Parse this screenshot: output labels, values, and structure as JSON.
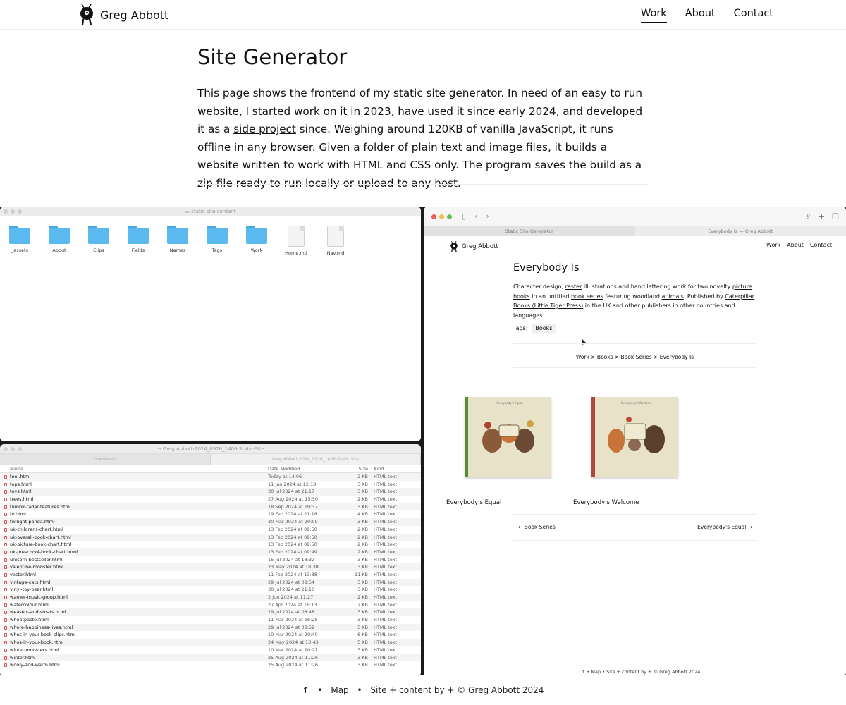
{
  "header": {
    "brand": "Greg Abbott",
    "nav": [
      {
        "label": "Work",
        "active": true
      },
      {
        "label": "About",
        "active": false
      },
      {
        "label": "Contact",
        "active": false
      }
    ]
  },
  "intro": {
    "title": "Site Generator",
    "text_1": "This page shows the frontend of my static site generator. In need of an easy to run website, I started work on it in 2023, have used it since early ",
    "link_year": "2024",
    "text_2": ", and developed it as a ",
    "link_side_project": "side project",
    "text_3": " since. Weighing around 120KB of vanilla JavaScript, it runs offline in any browser. Given a folder of plain text and image files, it builds a website written to work with HTML and CSS only. The program saves the build as a zip file ready to run locally or upload to any host."
  },
  "finder_content": {
    "title": "static site content",
    "items": [
      {
        "label": "_assets",
        "type": "folder"
      },
      {
        "label": "About",
        "type": "folder"
      },
      {
        "label": "Clips",
        "type": "folder"
      },
      {
        "label": "Fields",
        "type": "folder"
      },
      {
        "label": "Names",
        "type": "folder"
      },
      {
        "label": "Tags",
        "type": "folder"
      },
      {
        "label": "Work",
        "type": "folder"
      },
      {
        "label": "Home.md",
        "type": "file"
      },
      {
        "label": "Nav.md",
        "type": "file"
      }
    ]
  },
  "finder_build": {
    "title": "Greg Abbott-2024_0926_1406-Static-Site",
    "tabs": [
      "Downloads",
      "Greg Abbott-2024_0926_1406-Static-Site"
    ],
    "columns": {
      "name": "Name",
      "date": "Date Modified",
      "size": "Size",
      "kind": "Kind"
    },
    "rows": [
      {
        "name": "tool.html",
        "date": "Today at 14:06",
        "size": "2 KB",
        "kind": "HTML text"
      },
      {
        "name": "tops.html",
        "date": "11 Jan 2024 at 12:18",
        "size": "3 KB",
        "kind": "HTML text"
      },
      {
        "name": "toys.html",
        "date": "30 Jul 2024 at 21:17",
        "size": "3 KB",
        "kind": "HTML text"
      },
      {
        "name": "trees.html",
        "date": "27 Aug 2024 at 15:50",
        "size": "2 KB",
        "kind": "HTML text"
      },
      {
        "name": "tumblr-radar-features.html",
        "date": "18 Sep 2024 at 19:37",
        "size": "3 KB",
        "kind": "HTML text"
      },
      {
        "name": "tv.html",
        "date": "19 Feb 2024 at 21:18",
        "size": "4 KB",
        "kind": "HTML text"
      },
      {
        "name": "twilight-panda.html",
        "date": "30 Mar 2024 at 20:09",
        "size": "3 KB",
        "kind": "HTML text"
      },
      {
        "name": "uk-childrens-chart.html",
        "date": "13 Feb 2024 at 09:50",
        "size": "2 KB",
        "kind": "HTML text"
      },
      {
        "name": "uk-overall-book-chart.html",
        "date": "13 Feb 2024 at 09:50",
        "size": "2 KB",
        "kind": "HTML text"
      },
      {
        "name": "uk-picture-book-chart.html",
        "date": "13 Feb 2024 at 09:50",
        "size": "2 KB",
        "kind": "HTML text"
      },
      {
        "name": "uk-preschool-book-chart.html",
        "date": "13 Feb 2024 at 09:49",
        "size": "2 KB",
        "kind": "HTML text"
      },
      {
        "name": "unicorn-bestseller.html",
        "date": "15 Jul 2024 at 18:32",
        "size": "3 KB",
        "kind": "HTML text"
      },
      {
        "name": "valentine-monster.html",
        "date": "23 May 2024 at 18:38",
        "size": "3 KB",
        "kind": "HTML text"
      },
      {
        "name": "vector.html",
        "date": "11 Feb 2024 at 13:38",
        "size": "11 KB",
        "kind": "HTML text"
      },
      {
        "name": "vintage-cats.html",
        "date": "29 Jul 2024 at 08:54",
        "size": "3 KB",
        "kind": "HTML text"
      },
      {
        "name": "vinyl-toy-bear.html",
        "date": "30 Jul 2024 at 21:16",
        "size": "3 KB",
        "kind": "HTML text"
      },
      {
        "name": "warner-music-group.html",
        "date": "2 Jun 2024 at 11:27",
        "size": "2 KB",
        "kind": "HTML text"
      },
      {
        "name": "watercolour.html",
        "date": "27 Apr 2024 at 16:13",
        "size": "2 KB",
        "kind": "HTML text"
      },
      {
        "name": "weasels-and-stoats.html",
        "date": "29 Jul 2024 at 08:48",
        "size": "3 KB",
        "kind": "HTML text"
      },
      {
        "name": "wheatpaste.html",
        "date": "11 Mar 2024 at 16:28",
        "size": "3 KB",
        "kind": "HTML text"
      },
      {
        "name": "where-happiness-lives.html",
        "date": "29 Jul 2024 at 08:52",
        "size": "5 KB",
        "kind": "HTML text"
      },
      {
        "name": "whos-in-your-book-clips.html",
        "date": "10 Mar 2024 at 20:40",
        "size": "6 KB",
        "kind": "HTML text"
      },
      {
        "name": "whos-in-your-book.html",
        "date": "24 May 2024 at 13:43",
        "size": "5 KB",
        "kind": "HTML text"
      },
      {
        "name": "winter-monsters.html",
        "date": "10 Mar 2024 at 20:21",
        "size": "3 KB",
        "kind": "HTML text"
      },
      {
        "name": "winter.html",
        "date": "25 Aug 2024 at 11:26",
        "size": "3 KB",
        "kind": "HTML text"
      },
      {
        "name": "wooly-and-warm.html",
        "date": "25 Aug 2024 at 11:26",
        "size": "3 KB",
        "kind": "HTML text"
      }
    ]
  },
  "browser": {
    "tabs": [
      "Static Site Generator",
      "Everybody Is — Greg Abbott"
    ],
    "brand": "Greg Abbott",
    "nav": [
      {
        "label": "Work",
        "active": true
      },
      {
        "label": "About",
        "active": false
      },
      {
        "label": "Contact",
        "active": false
      }
    ],
    "title": "Everybody Is",
    "desc_1": "Character design, ",
    "link_raster": "raster",
    "desc_2": " illustrations and hand lettering work for two novelty ",
    "link_picture_books": "picture books",
    "desc_3": " in an untitled ",
    "link_book_series": "book series",
    "desc_4": " featuring woodland ",
    "link_animals": "animals",
    "desc_5": ". Published by ",
    "link_publisher": "Caterpillar Books (Little Tiger Press)",
    "desc_6": " in the UK and other publishers in other countries and languages.",
    "tags_label": "Tags:",
    "tag": "Books",
    "breadcrumb": "Work > Books > Book Series > Everybody Is",
    "books": [
      {
        "label": "Everybody's Equal",
        "cover_title": "Everybody's Equal"
      },
      {
        "label": "Everybody's Welcome",
        "cover_title": "Everybody's Welcome"
      }
    ],
    "prev": "← Book Series",
    "next": "Everybody's Equal →",
    "footer": "↑  •  Map  •  Site + content by + © Greg Abbott 2024"
  },
  "footer": {
    "up": "↑",
    "map": "Map",
    "credit": "Site + content by + © Greg Abbott 2024"
  },
  "colors": {
    "folder": "#5ab9ef",
    "traffic_red": "#ee5f57",
    "traffic_yellow": "#f5bd4f",
    "traffic_green": "#5fc454"
  }
}
